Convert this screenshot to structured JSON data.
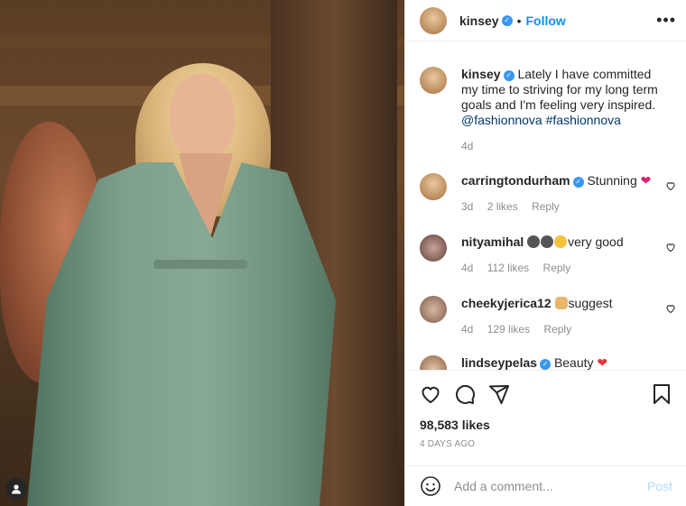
{
  "post": {
    "username": "kinsey",
    "follow_label": "Follow",
    "separator": "•",
    "more_label": "•••"
  },
  "caption": {
    "username": "kinsey",
    "text": "Lately I have committed my time to striving for my long term goals and I'm feeling very inspired.",
    "tags": "@fashionnova #fashionnova",
    "time": "4d"
  },
  "comments": [
    {
      "username": "carringtondurham",
      "verified": true,
      "text": "Stunning",
      "time": "3d",
      "likes": "2 likes",
      "reply": "Reply"
    },
    {
      "username": "nityamihal",
      "verified": false,
      "text": "very good",
      "time": "4d",
      "likes": "112 likes",
      "reply": "Reply"
    },
    {
      "username": "cheekyjerica12",
      "verified": false,
      "text": "suggest",
      "time": "4d",
      "likes": "129 likes",
      "reply": "Reply"
    },
    {
      "username": "lindseypelas",
      "verified": true,
      "text": "Beauty",
      "time": "",
      "likes": "",
      "reply": ""
    }
  ],
  "stats": {
    "likes": "98,583 likes",
    "date": "4 DAYS AGO"
  },
  "add_comment": {
    "placeholder": "Add a comment...",
    "post_label": "Post"
  },
  "colors": {
    "accent": "#0095f6",
    "verified": "#3897f0",
    "muted": "#8e8e8e",
    "post_disabled": "#b3dbff"
  },
  "icons": {
    "like": "heart-icon",
    "comment": "comment-icon",
    "share": "share-icon",
    "save": "bookmark-icon",
    "emoji": "smiley-icon",
    "tagged": "user-icon"
  }
}
